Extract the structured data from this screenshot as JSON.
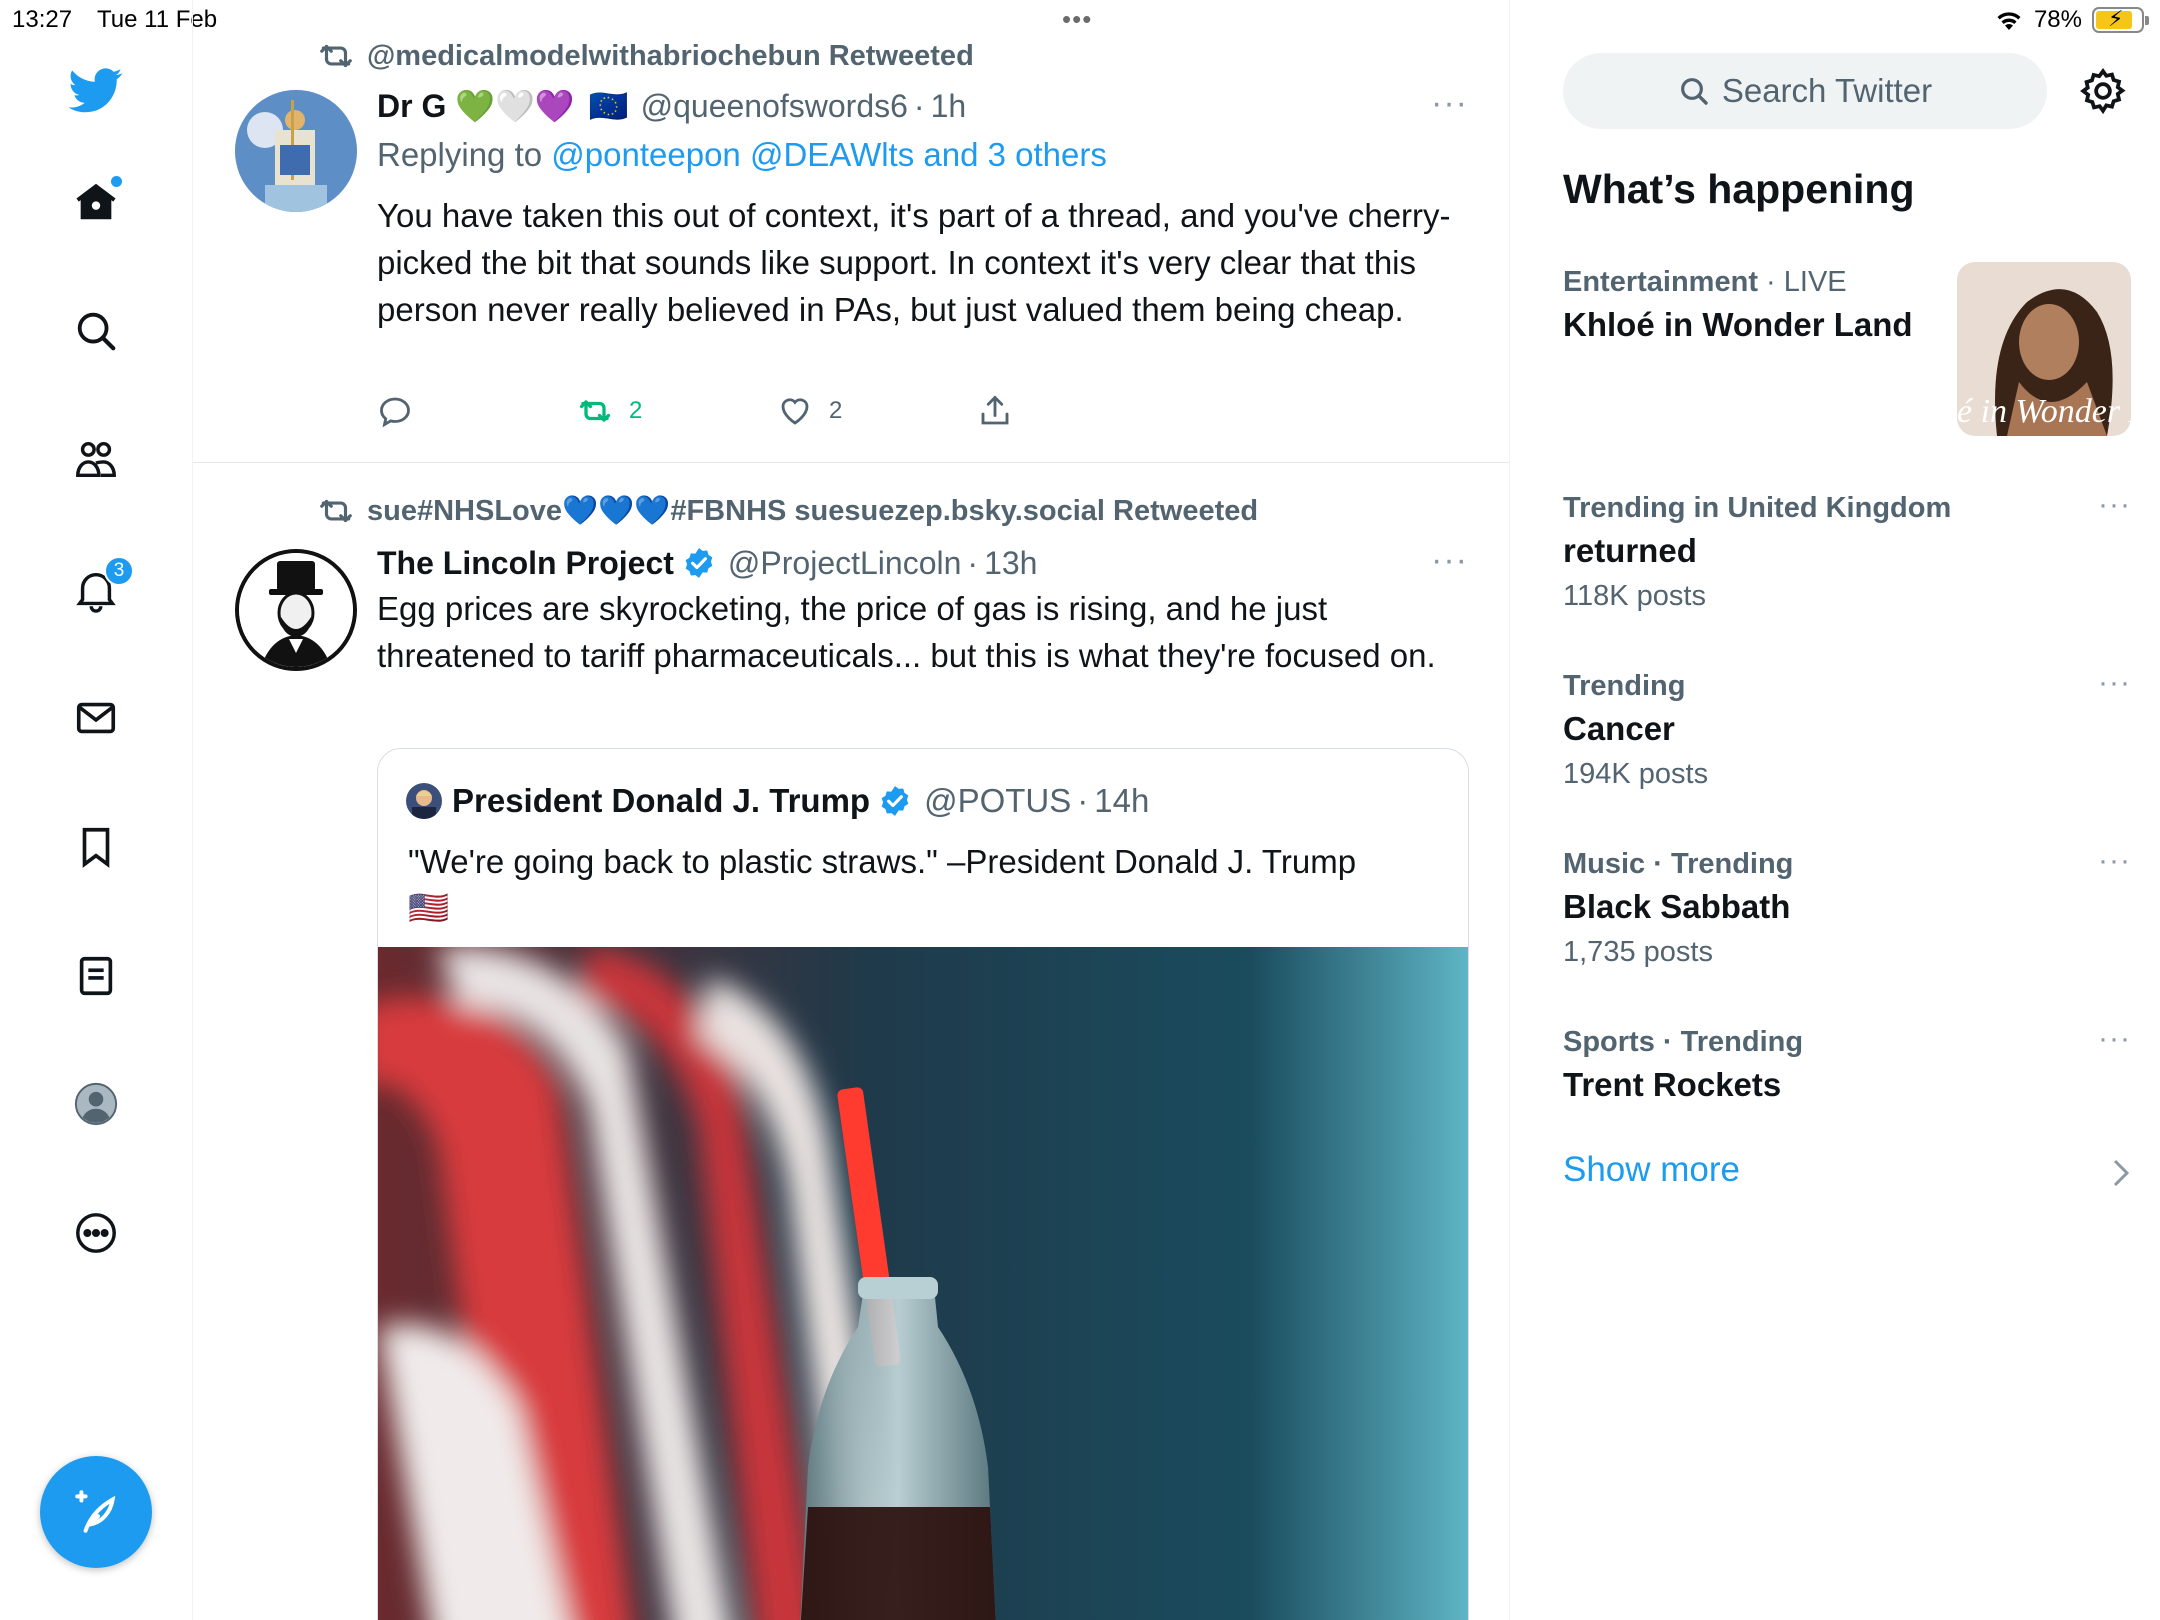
{
  "status_bar": {
    "time": "13:27",
    "date": "Tue 11 Feb",
    "battery": "78%",
    "battery_level": 0.78
  },
  "nav": {
    "items": [
      "home-icon",
      "explore-icon",
      "communities-icon",
      "notifications-icon",
      "messages-icon",
      "bookmarks-icon",
      "lists-icon",
      "profile-icon",
      "more-icon"
    ],
    "notifications_badge": "3",
    "compose_icon": "compose-icon"
  },
  "tweets": [
    {
      "retweeted_by": "@medicalmodelwithabriochebun Retweeted",
      "name": "Dr G 💚🤍💜",
      "flag": "🇪🇺",
      "handle": "@queenofswords6",
      "sep": "·",
      "time": "1h",
      "replying_prefix": "Replying to",
      "replying_to": "@ponteepon @DEAWlts and 3 others",
      "text": "You have taken this out of context, it's part of a thread, and you've cherry-picked the bit that sounds like support. In context it's very clear that this person never really believed in PAs, but just valued them being cheap.",
      "retweets": "2",
      "likes": "2",
      "more": "···"
    },
    {
      "retweeted_by": "sue#NHSLove💙💙💙#FBNHS suesuezep.bsky.social Retweeted",
      "name": "The Lincoln Project",
      "handle": "@ProjectLincoln",
      "sep": "·",
      "time": "13h",
      "text": "Egg prices are skyrocketing, the price of gas is rising, and he just threatened to tariff pharmaceuticals... but this is what they're focused on.",
      "more": "···",
      "quote": {
        "name": "President Donald J. Trump",
        "handle": "@POTUS",
        "sep": "·",
        "time": "14h",
        "text": "\"We're going back to plastic straws.\" –President Donald J. Trump",
        "flag": "🇺🇸"
      }
    }
  ],
  "sidebar": {
    "search_placeholder": "Search Twitter",
    "title": "What’s happening",
    "trends": [
      {
        "category": "Entertainment",
        "sep": " · ",
        "status": "LIVE",
        "name": "Khloé in Wonder Land",
        "count": "",
        "thumb_caption": "é in Wonder L"
      },
      {
        "category": "Trending in United Kingdom",
        "sep": "",
        "status": "",
        "name": "returned",
        "count": "118K posts"
      },
      {
        "category": "Trending",
        "sep": "",
        "status": "",
        "name": "Cancer",
        "count": "194K posts"
      },
      {
        "category": "Music · Trending",
        "sep": "",
        "status": "",
        "name": "Black Sabbath",
        "count": "1,735 posts"
      },
      {
        "category": "Sports · Trending",
        "sep": "",
        "status": "",
        "name": "Trent Rockets",
        "count": ""
      }
    ],
    "show_more": "Show more",
    "more": "···"
  },
  "colors": {
    "accent": "#1d9bf0",
    "retweet_green": "#00ba7c",
    "secondary_text": "#536471"
  }
}
